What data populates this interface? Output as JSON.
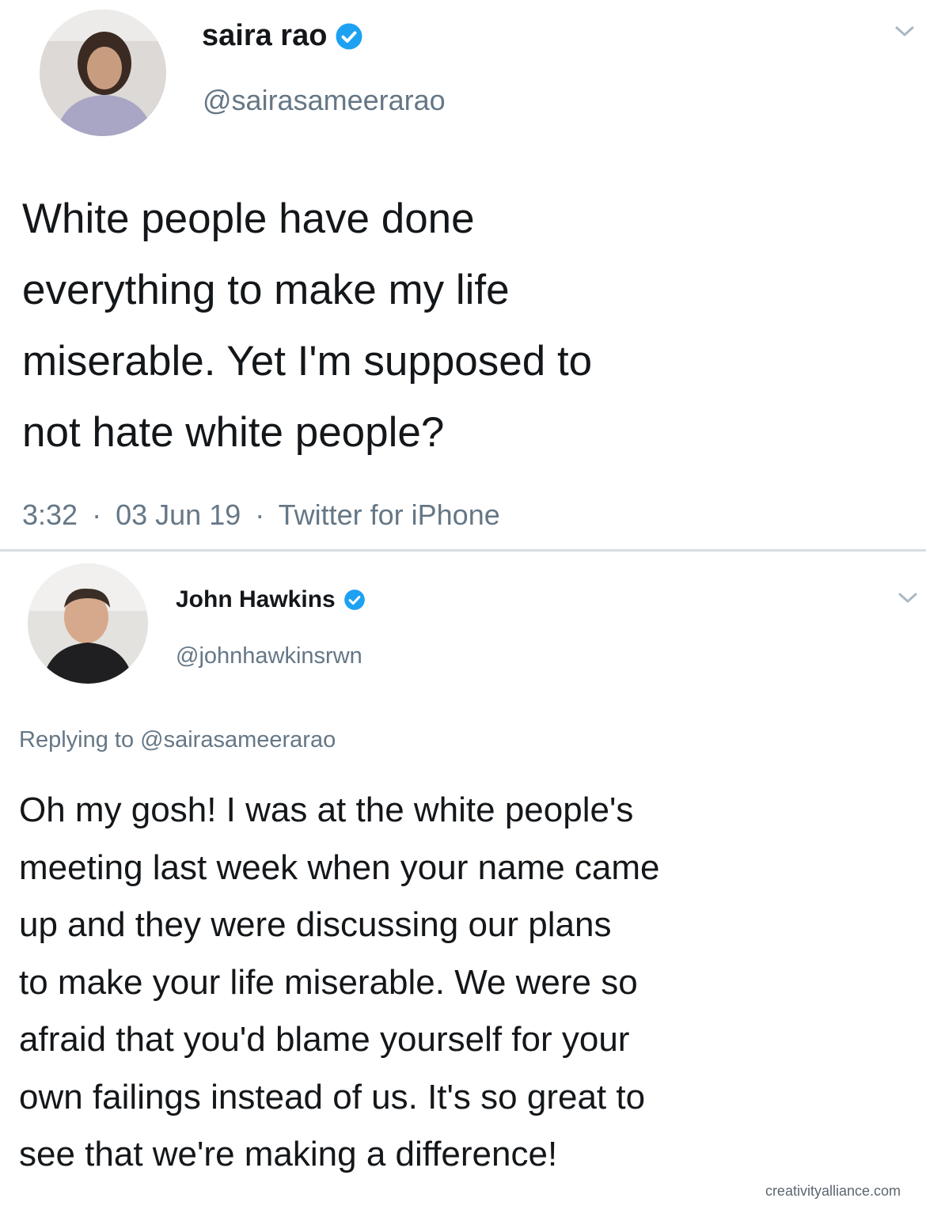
{
  "tweet1": {
    "display_name": "saira rao",
    "handle": "@sairasameerarao",
    "text_lines": [
      "White people have done",
      "everything to make my life",
      "miserable. Yet I'm supposed to",
      "not hate white people?"
    ],
    "time": "3:32",
    "date": "03 Jun 19",
    "source": "Twitter for iPhone",
    "separator": "·"
  },
  "tweet2": {
    "display_name": "John Hawkins",
    "handle": "@johnhawkinsrwn",
    "replying_to_label": "Replying to",
    "replying_to_handle": "@sairasameerarao",
    "text_lines": [
      "Oh my gosh! I was at the white people's",
      "meeting last week when your name came",
      "up and they were discussing our plans",
      "to make your life miserable. We were so",
      "afraid that you'd blame yourself for your",
      "own failings instead of us. It's so great to",
      "see that we're making a difference!"
    ]
  },
  "watermark": "creativityalliance.com",
  "icons": {
    "verified": "verified-badge-icon",
    "menu": "chevron-down-icon"
  },
  "colors": {
    "verified": "#1da1f2",
    "secondary_text": "#657786",
    "primary_text": "#14171a"
  }
}
